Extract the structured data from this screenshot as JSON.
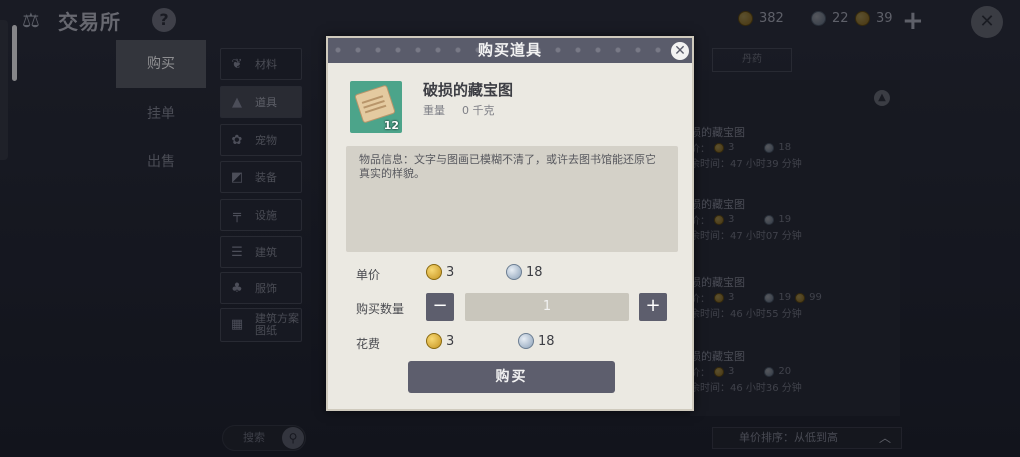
{
  "app": {
    "title": "交易所",
    "help": "?"
  },
  "currency": [
    {
      "icon": "coin-icon",
      "value": "382"
    },
    {
      "icon": "moon-coin-icon",
      "value": "22"
    },
    {
      "icon": "coin-icon",
      "value": "39"
    }
  ],
  "side_tabs": [
    {
      "label": "购买",
      "active": true
    },
    {
      "label": "挂单",
      "active": false
    },
    {
      "label": "出售",
      "active": false
    }
  ],
  "categories": [
    {
      "label": "材料",
      "icon": "leaf-icon"
    },
    {
      "label": "道具",
      "icon": "flask-icon"
    },
    {
      "label": "宠物",
      "icon": "paw-icon"
    },
    {
      "label": "装备",
      "icon": "armor-icon"
    },
    {
      "label": "设施",
      "icon": "facility-icon"
    },
    {
      "label": "建筑",
      "icon": "building-icon"
    },
    {
      "label": "服饰",
      "icon": "clothing-icon"
    },
    {
      "label": "建筑方案\n图纸",
      "icon": "blueprint-icon"
    }
  ],
  "search": {
    "placeholder": "搜索"
  },
  "list": {
    "header_tab": "丹药",
    "items": [
      {
        "name": "损的藏宝图",
        "unit_label": "价：",
        "coin": "3",
        "moon": "18",
        "extra": "",
        "time": "余时间：47 小时39 分钟"
      },
      {
        "name": "损的藏宝图",
        "unit_label": "价：",
        "coin": "3",
        "moon": "19",
        "extra": "",
        "time": "余时间：47 小时07 分钟"
      },
      {
        "name": "损的藏宝图",
        "unit_label": "价：",
        "coin": "3",
        "moon": "19",
        "extra": "99",
        "time": "余时间：46 小时55 分钟"
      },
      {
        "name": "损的藏宝图",
        "unit_label": "价：",
        "coin": "3",
        "moon": "20",
        "extra": "",
        "time": "余时间：46 小时36 分钟"
      }
    ],
    "sort_label": "单价排序：从低到高"
  },
  "modal": {
    "title": "购买道具",
    "item_name": "破损的藏宝图",
    "item_count": "12",
    "weight_label": "重量",
    "weight_value": "0 千克",
    "description": "物品信息：文字与图画已模糊不清了，或许去图书馆能还原它真实的样貌。",
    "unit_price_label": "单价",
    "unit_price_coin": "3",
    "unit_price_moon": "18",
    "qty_label": "购买数量",
    "qty_minus": "−",
    "qty_value": "1",
    "qty_plus": "+",
    "cost_label": "花费",
    "cost_coin": "3",
    "cost_moon": "18",
    "buy_label": "购买"
  }
}
